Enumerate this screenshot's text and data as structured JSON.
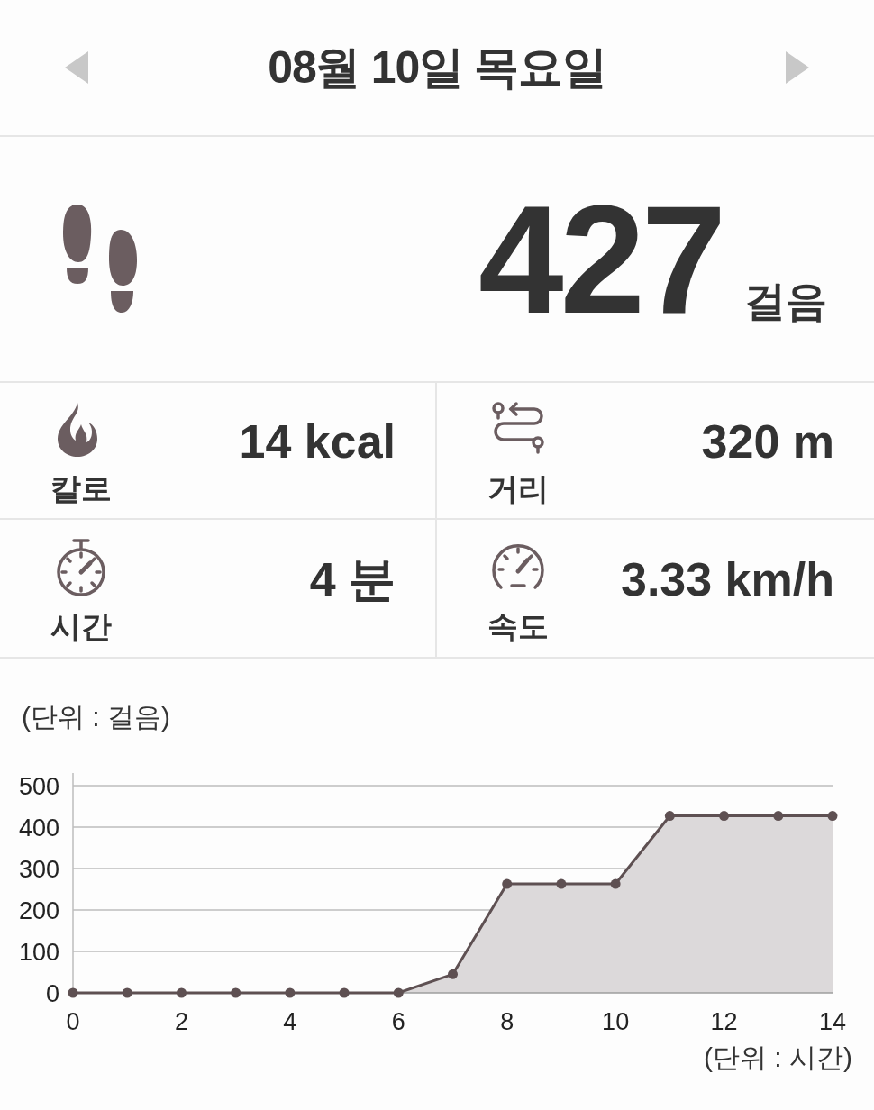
{
  "header": {
    "date": "08월 10일 목요일"
  },
  "steps": {
    "value": "427",
    "unit": "걸음"
  },
  "stats": [
    {
      "kind": "calories",
      "label": "칼로",
      "value": "14 kcal"
    },
    {
      "kind": "distance",
      "label": "거리",
      "value": "320 m"
    },
    {
      "kind": "time",
      "label": "시간",
      "value": "4 분"
    },
    {
      "kind": "speed",
      "label": "속도",
      "value": "3.33 km/h"
    }
  ],
  "chart": {
    "chart_data": {
      "type": "area",
      "ylabel": "(단위 : 걸음)",
      "xlabel": "(단위 : 시간)",
      "x": [
        0,
        1,
        2,
        3,
        4,
        5,
        6,
        7,
        8,
        9,
        10,
        11,
        12,
        13,
        14
      ],
      "values": [
        0,
        0,
        0,
        0,
        0,
        0,
        0,
        45,
        263,
        263,
        263,
        427,
        427,
        427,
        427
      ],
      "xlim": [
        0,
        14
      ],
      "ylim": [
        0,
        500
      ],
      "xticks": [
        0,
        2,
        4,
        6,
        8,
        10,
        12,
        14
      ],
      "yticks": [
        0,
        100,
        200,
        300,
        400,
        500
      ],
      "grid": true
    }
  }
}
